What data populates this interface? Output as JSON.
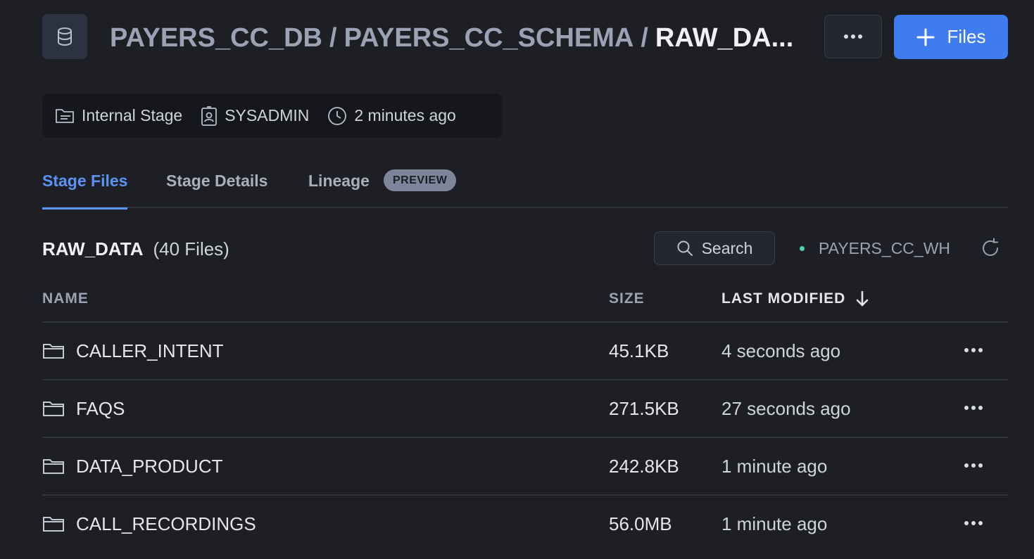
{
  "header": {
    "breadcrumb": {
      "database": "PAYERS_CC_DB",
      "separator": "/",
      "schema": "PAYERS_CC_SCHEMA",
      "current": "RAW_DA..."
    },
    "files_button_label": "Files",
    "icons": {
      "object": "database-icon",
      "more": "more-horizontal-icon",
      "add": "plus-icon"
    }
  },
  "meta": {
    "stage_type": "Internal Stage",
    "owner": "SYSADMIN",
    "updated": "2 minutes ago"
  },
  "tabs": [
    {
      "label": "Stage Files",
      "active": true
    },
    {
      "label": "Stage Details",
      "active": false
    },
    {
      "label": "Lineage",
      "active": false,
      "badge": "PREVIEW"
    }
  ],
  "listing": {
    "stage_name": "RAW_DATA",
    "file_count": "(40 Files)",
    "search_label": "Search",
    "warehouse": "PAYERS_CC_WH"
  },
  "table": {
    "columns": {
      "name": "NAME",
      "size": "SIZE",
      "modified": "LAST MODIFIED"
    },
    "rows": [
      {
        "name": "CALLER_INTENT",
        "size": "45.1KB",
        "modified": "4 seconds ago"
      },
      {
        "name": "FAQS",
        "size": "271.5KB",
        "modified": "27 seconds ago"
      },
      {
        "name": "DATA_PRODUCT",
        "size": "242.8KB",
        "modified": "1 minute ago"
      },
      {
        "name": "CALL_RECORDINGS",
        "size": "56.0MB",
        "modified": "1 minute ago"
      }
    ]
  },
  "colors": {
    "background": "#1d1f25",
    "accent": "#3e7cf0",
    "active_tab": "#5b93f2",
    "status_ok": "#4cd6a1"
  }
}
